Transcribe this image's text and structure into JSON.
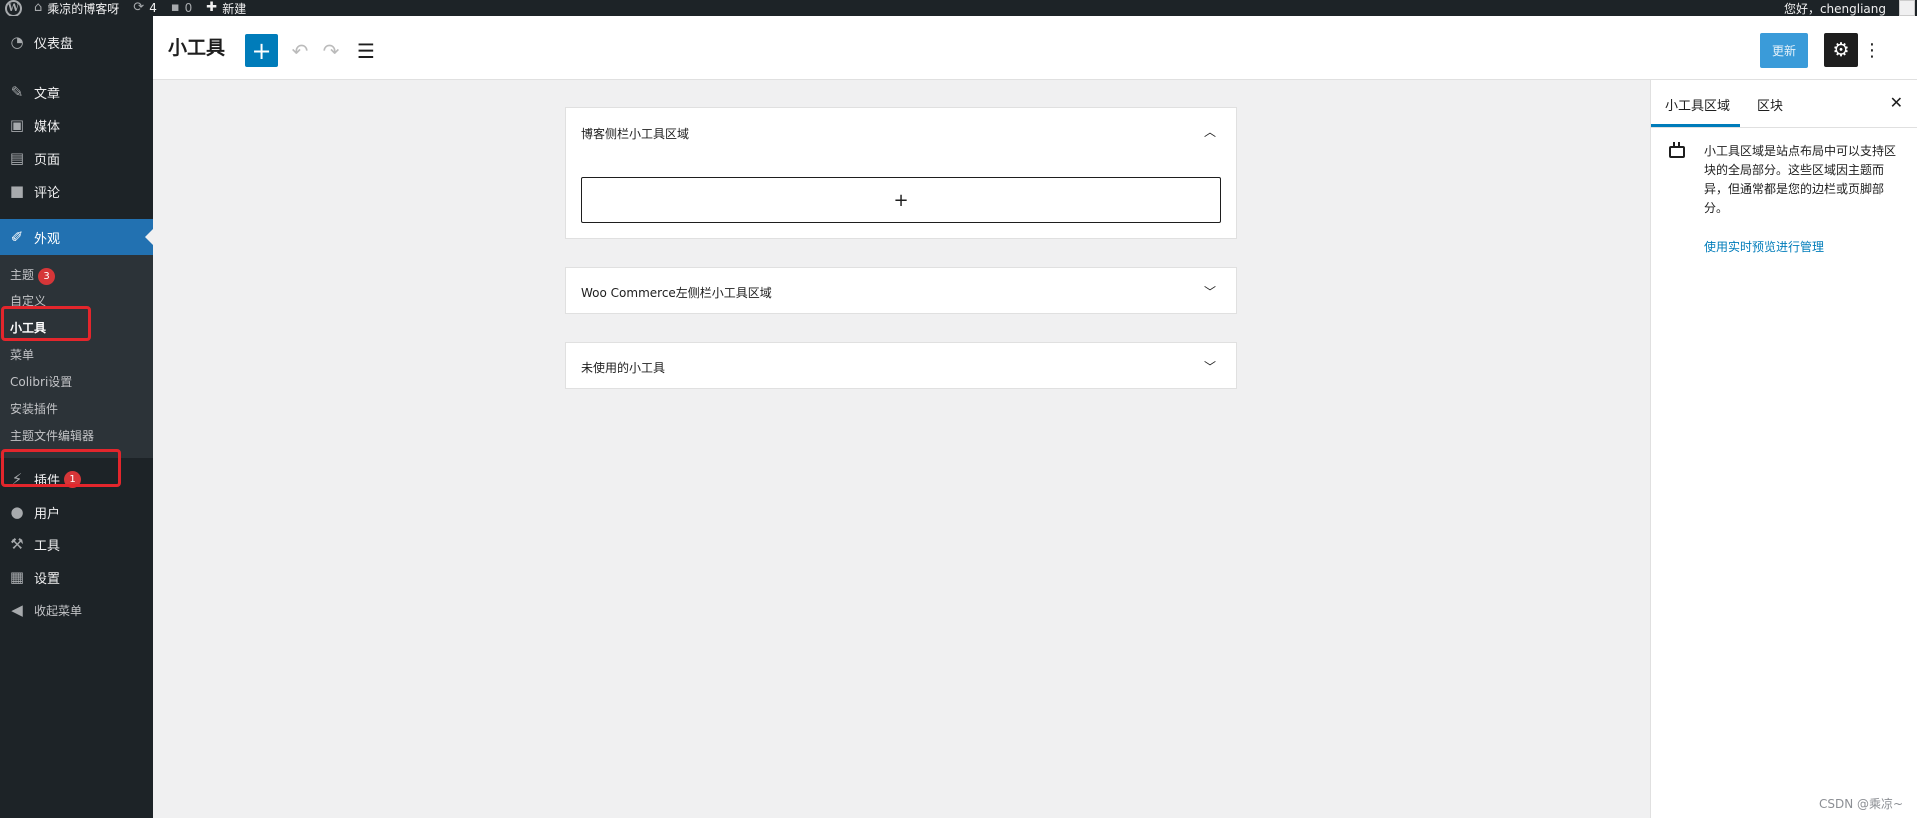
{
  "admin_bar": {
    "logo": "W",
    "site_name": "乘凉的博客呀",
    "updates_count": "4",
    "comments_count": "0",
    "new_label": "新建",
    "greeting": "您好，chengliang"
  },
  "menu": {
    "dashboard": "仪表盘",
    "posts": "文章",
    "media": "媒体",
    "pages": "页面",
    "comments": "评论",
    "appearance": "外观",
    "appearance_sub": {
      "themes": "主题",
      "themes_badge": "3",
      "customize": "自定义",
      "widgets": "小工具",
      "menus": "菜单",
      "colibri": "Colibri设置",
      "install_plugins": "安装插件",
      "theme_editor": "主题文件编辑器"
    },
    "plugins": "插件",
    "plugins_badge": "1",
    "users": "用户",
    "tools": "工具",
    "settings": "设置",
    "collapse": "收起菜单"
  },
  "header": {
    "title": "小工具",
    "update_label": "更新"
  },
  "widget_areas": [
    {
      "title": "博客侧栏小工具区域",
      "expanded": true
    },
    {
      "title": "Woo Commerce左侧栏小工具区域",
      "expanded": false
    },
    {
      "title": "未使用的小工具",
      "expanded": false
    }
  ],
  "sidebar": {
    "tab_widget_areas": "小工具区域",
    "tab_block": "区块",
    "description": "小工具区域是站点布局中可以支持区块的全局部分。这些区域因主题而异，但通常都是您的边栏或页脚部分。",
    "preview_link": "使用实时预览进行管理"
  },
  "watermark": "CSDN @乘凉~",
  "colors": {
    "accent": "#007cba",
    "admin_dark": "#1d2327",
    "menu_current": "#2271b1",
    "badge": "#d63638",
    "highlight": "#e3262c"
  }
}
